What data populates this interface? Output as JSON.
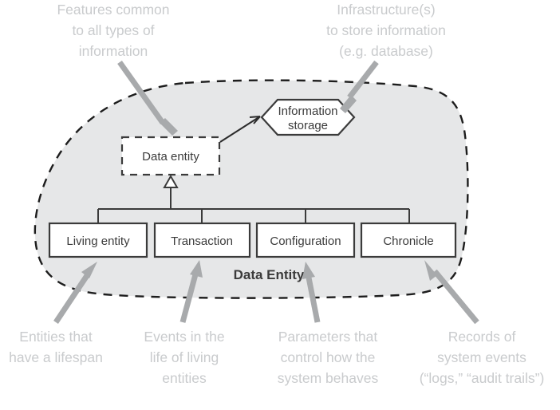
{
  "diagram": {
    "title": "Data Entity",
    "group_label": "Data Entity",
    "blob": {
      "fill_color": "#e6e7e8",
      "border_color": "#1d1d1d",
      "border_style": "dashed"
    },
    "nodes": {
      "abstract": {
        "label": "Data entity",
        "style": "dashed-rectangle"
      },
      "storage": {
        "label_line1": "Information",
        "label_line2": "storage",
        "style": "hexagon"
      },
      "subtypes": [
        {
          "label": "Living entity"
        },
        {
          "label": "Transaction"
        },
        {
          "label": "Configuration"
        },
        {
          "label": "Chronicle"
        }
      ]
    },
    "callouts": {
      "features": {
        "lines": [
          "Features common",
          "to all types of",
          "information"
        ],
        "points_to": "abstract-data-entity-node"
      },
      "infrastructure": {
        "lines": [
          "Infrastructure(s)",
          "to store information",
          "(e.g. database)"
        ],
        "points_to": "information-storage-node"
      },
      "living_entity": {
        "lines": [
          "Entities that",
          "have a lifespan"
        ],
        "points_to": "living-entity-node"
      },
      "transaction": {
        "lines": [
          "Events in the",
          "life of living",
          "entities"
        ],
        "points_to": "transaction-node"
      },
      "configuration": {
        "lines": [
          "Parameters that",
          "control how the",
          "system behaves"
        ],
        "points_to": "configuration-node"
      },
      "chronicle": {
        "lines": [
          "Records of",
          "system events",
          "(“logs,” “audit trails”)"
        ],
        "points_to": "chronicle-node"
      }
    },
    "colors": {
      "blob_fill": "#e6e7e8",
      "outline": "#1d1d1d",
      "node_stroke": "#3b3b3b",
      "callout_text": "#c9cbcd",
      "callout_arrow": "#a8aaac",
      "node_text": "#3b3b3b"
    }
  }
}
